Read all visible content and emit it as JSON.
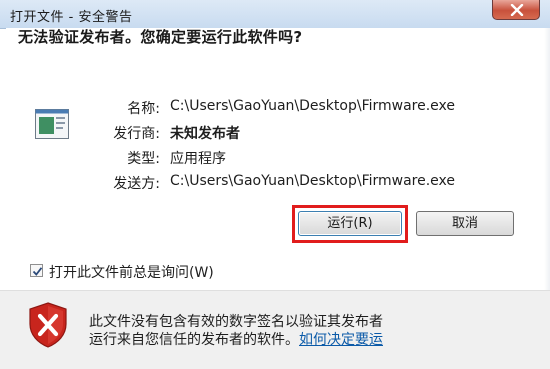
{
  "window": {
    "title": "打开文件 - 安全警告"
  },
  "dialog": {
    "heading": "无法验证发布者。您确定要运行此软件吗?",
    "fields": [
      {
        "key": "名称:",
        "value": "C:\\Users\\GaoYuan\\Desktop\\Firmware.exe"
      },
      {
        "key": "发行商:",
        "value": "未知发布者"
      },
      {
        "key": "类型:",
        "value": "应用程序"
      },
      {
        "key": "发送方:",
        "value": "C:\\Users\\GaoYuan\\Desktop\\Firmware.exe"
      }
    ],
    "buttons": {
      "run": "运行(R)",
      "cancel": "取消"
    },
    "checkbox": {
      "label": "打开此文件前总是询问(W)",
      "checked": true
    }
  },
  "footer": {
    "line1": "此文件没有包含有效的数字签名以验证其发布者",
    "line2_text": "运行来自您信任的发布者的软件。",
    "link": "如何决定要运"
  },
  "icons": {
    "close": "close-icon",
    "app": "application-icon",
    "shield": "shield-warning-icon",
    "checkbox": "checkmark-icon"
  },
  "colors": {
    "highlight": "#e11c1c",
    "link": "#0b5aa8",
    "shield_red": "#c8251d"
  }
}
